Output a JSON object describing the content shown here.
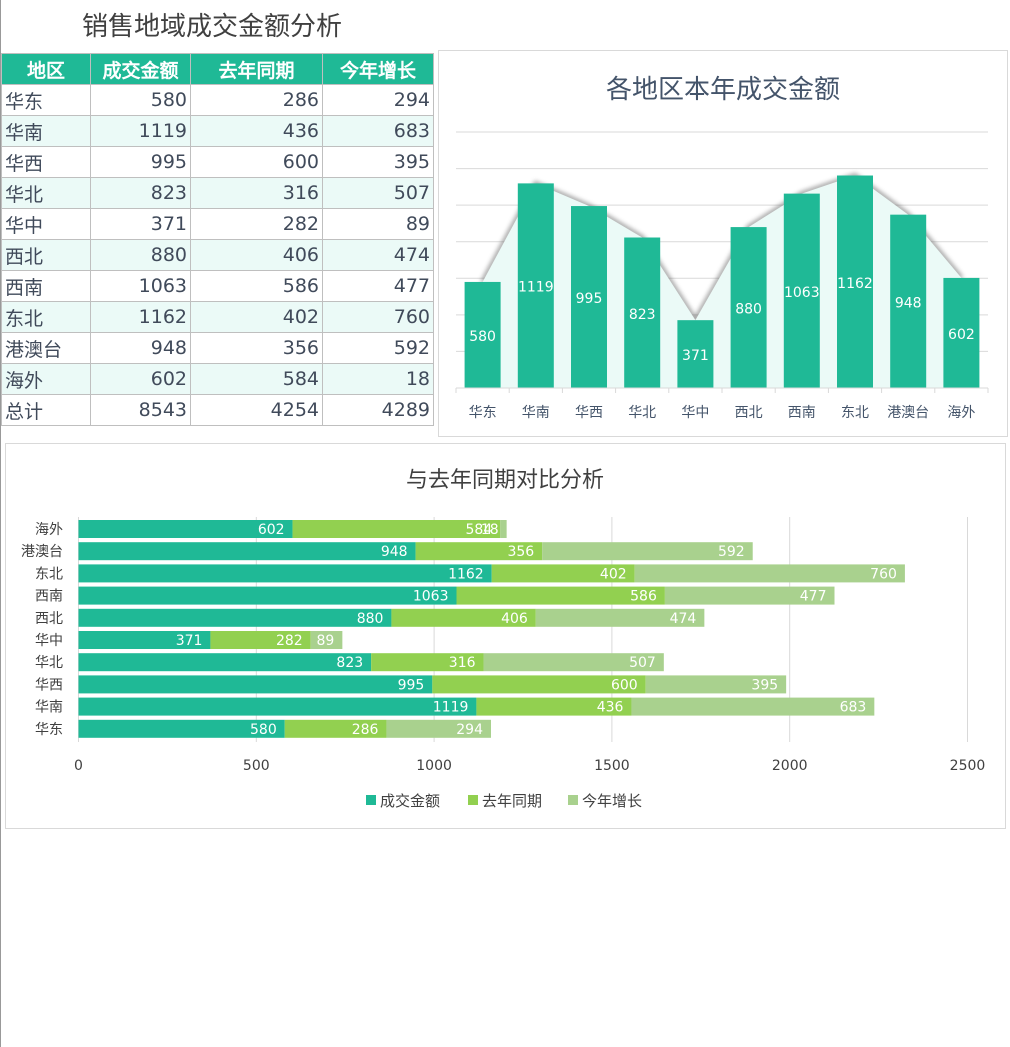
{
  "title": "销售地域成交金额分析",
  "table": {
    "headers": [
      "地区",
      "成交金额",
      "去年同期",
      "今年增长"
    ],
    "rows": [
      [
        "华东",
        "580",
        "286",
        "294"
      ],
      [
        "华南",
        "1119",
        "436",
        "683"
      ],
      [
        "华西",
        "995",
        "600",
        "395"
      ],
      [
        "华北",
        "823",
        "316",
        "507"
      ],
      [
        "华中",
        "371",
        "282",
        "89"
      ],
      [
        "西北",
        "880",
        "406",
        "474"
      ],
      [
        "西南",
        "1063",
        "586",
        "477"
      ],
      [
        "东北",
        "1162",
        "402",
        "760"
      ],
      [
        "港澳台",
        "948",
        "356",
        "592"
      ],
      [
        "海外",
        "602",
        "584",
        "18"
      ],
      [
        "总计",
        "8543",
        "4254",
        "4289"
      ]
    ]
  },
  "colors": {
    "header": "#1fb996",
    "alt_row": "#ebfaf7",
    "series": [
      "#1fb996",
      "#92d050",
      "#a9d18e"
    ]
  },
  "chart_data": [
    {
      "type": "bar",
      "title": "各地区本年成交金额",
      "categories": [
        "华东",
        "华南",
        "华西",
        "华北",
        "华中",
        "西北",
        "西南",
        "东北",
        "港澳台",
        "海外"
      ],
      "values": [
        580,
        1119,
        995,
        823,
        371,
        880,
        1063,
        1162,
        948,
        602
      ],
      "ylim": [
        0,
        1400
      ],
      "grid": true,
      "overlay": "area"
    },
    {
      "type": "bar",
      "orientation": "horizontal",
      "stacked": true,
      "title": "与去年同期对比分析",
      "categories": [
        "华东",
        "华南",
        "华西",
        "华北",
        "华中",
        "西北",
        "西南",
        "东北",
        "港澳台",
        "海外"
      ],
      "series": [
        {
          "name": "成交金额",
          "values": [
            580,
            1119,
            995,
            823,
            371,
            880,
            1063,
            1162,
            948,
            602
          ]
        },
        {
          "name": "去年同期",
          "values": [
            286,
            436,
            600,
            316,
            282,
            406,
            586,
            402,
            356,
            584
          ]
        },
        {
          "name": "今年增长",
          "values": [
            294,
            683,
            395,
            507,
            89,
            474,
            477,
            760,
            592,
            18
          ]
        }
      ],
      "xlim": [
        0,
        2500
      ],
      "xticks": [
        0,
        500,
        1000,
        1500,
        2000,
        2500
      ],
      "grid": true,
      "legend": "bottom"
    }
  ]
}
